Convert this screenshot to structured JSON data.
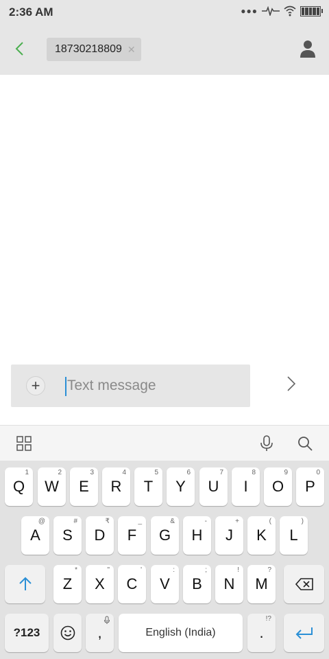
{
  "status_bar": {
    "time": "2:36 AM",
    "icons": [
      "more-dots-icon",
      "activity-icon",
      "wifi-icon",
      "battery-icon"
    ]
  },
  "header": {
    "back_icon": "chevron-left-icon",
    "recipient": "18730218809",
    "remove_icon": "close-icon",
    "contact_icon": "person-icon"
  },
  "compose": {
    "attach_label": "+",
    "placeholder": "Text message",
    "value": "",
    "send_icon": "chevron-right-icon"
  },
  "keyboard": {
    "toolbar": [
      "grid-icon",
      "microphone-icon",
      "search-icon"
    ],
    "row1": [
      {
        "key": "Q",
        "sub": "1"
      },
      {
        "key": "W",
        "sub": "2"
      },
      {
        "key": "E",
        "sub": "3"
      },
      {
        "key": "R",
        "sub": "4"
      },
      {
        "key": "T",
        "sub": "5"
      },
      {
        "key": "Y",
        "sub": "6"
      },
      {
        "key": "U",
        "sub": "7"
      },
      {
        "key": "I",
        "sub": "8"
      },
      {
        "key": "O",
        "sub": "9"
      },
      {
        "key": "P",
        "sub": "0"
      }
    ],
    "row2": [
      {
        "key": "A",
        "sub": "@"
      },
      {
        "key": "S",
        "sub": "#"
      },
      {
        "key": "D",
        "sub": "₹"
      },
      {
        "key": "F",
        "sub": "_"
      },
      {
        "key": "G",
        "sub": "&"
      },
      {
        "key": "H",
        "sub": "-"
      },
      {
        "key": "J",
        "sub": "+"
      },
      {
        "key": "K",
        "sub": "("
      },
      {
        "key": "L",
        "sub": ")"
      }
    ],
    "row3": [
      {
        "key": "Z",
        "sub": "*"
      },
      {
        "key": "X",
        "sub": "\""
      },
      {
        "key": "C",
        "sub": "'"
      },
      {
        "key": "V",
        "sub": ":"
      },
      {
        "key": "B",
        "sub": ";"
      },
      {
        "key": "N",
        "sub": "!"
      },
      {
        "key": "M",
        "sub": "?"
      }
    ],
    "numbers_label": "?123",
    "comma": ",",
    "space_label": "English (India)",
    "period": ".",
    "period_sub": "!?",
    "accent_color": "#2a8fd6"
  }
}
